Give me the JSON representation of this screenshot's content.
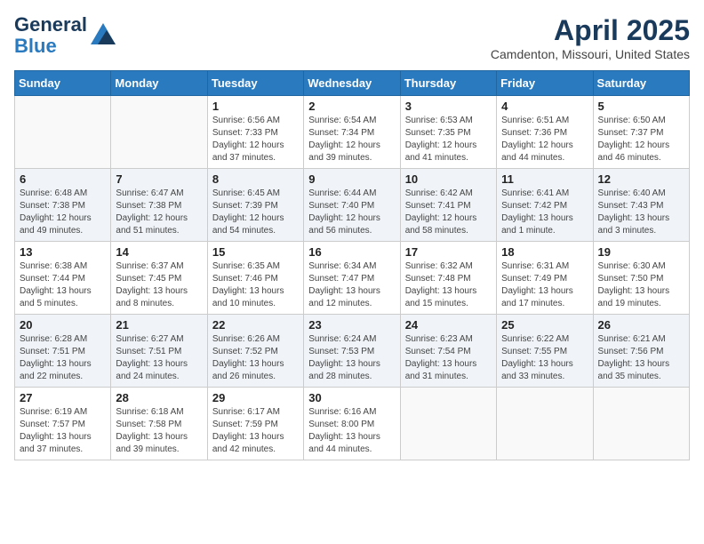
{
  "header": {
    "logo_line1": "General",
    "logo_line2": "Blue",
    "month_title": "April 2025",
    "location": "Camdenton, Missouri, United States"
  },
  "days_of_week": [
    "Sunday",
    "Monday",
    "Tuesday",
    "Wednesday",
    "Thursday",
    "Friday",
    "Saturday"
  ],
  "weeks": [
    [
      {
        "day": "",
        "info": ""
      },
      {
        "day": "",
        "info": ""
      },
      {
        "day": "1",
        "info": "Sunrise: 6:56 AM\nSunset: 7:33 PM\nDaylight: 12 hours and 37 minutes."
      },
      {
        "day": "2",
        "info": "Sunrise: 6:54 AM\nSunset: 7:34 PM\nDaylight: 12 hours and 39 minutes."
      },
      {
        "day": "3",
        "info": "Sunrise: 6:53 AM\nSunset: 7:35 PM\nDaylight: 12 hours and 41 minutes."
      },
      {
        "day": "4",
        "info": "Sunrise: 6:51 AM\nSunset: 7:36 PM\nDaylight: 12 hours and 44 minutes."
      },
      {
        "day": "5",
        "info": "Sunrise: 6:50 AM\nSunset: 7:37 PM\nDaylight: 12 hours and 46 minutes."
      }
    ],
    [
      {
        "day": "6",
        "info": "Sunrise: 6:48 AM\nSunset: 7:38 PM\nDaylight: 12 hours and 49 minutes."
      },
      {
        "day": "7",
        "info": "Sunrise: 6:47 AM\nSunset: 7:38 PM\nDaylight: 12 hours and 51 minutes."
      },
      {
        "day": "8",
        "info": "Sunrise: 6:45 AM\nSunset: 7:39 PM\nDaylight: 12 hours and 54 minutes."
      },
      {
        "day": "9",
        "info": "Sunrise: 6:44 AM\nSunset: 7:40 PM\nDaylight: 12 hours and 56 minutes."
      },
      {
        "day": "10",
        "info": "Sunrise: 6:42 AM\nSunset: 7:41 PM\nDaylight: 12 hours and 58 minutes."
      },
      {
        "day": "11",
        "info": "Sunrise: 6:41 AM\nSunset: 7:42 PM\nDaylight: 13 hours and 1 minute."
      },
      {
        "day": "12",
        "info": "Sunrise: 6:40 AM\nSunset: 7:43 PM\nDaylight: 13 hours and 3 minutes."
      }
    ],
    [
      {
        "day": "13",
        "info": "Sunrise: 6:38 AM\nSunset: 7:44 PM\nDaylight: 13 hours and 5 minutes."
      },
      {
        "day": "14",
        "info": "Sunrise: 6:37 AM\nSunset: 7:45 PM\nDaylight: 13 hours and 8 minutes."
      },
      {
        "day": "15",
        "info": "Sunrise: 6:35 AM\nSunset: 7:46 PM\nDaylight: 13 hours and 10 minutes."
      },
      {
        "day": "16",
        "info": "Sunrise: 6:34 AM\nSunset: 7:47 PM\nDaylight: 13 hours and 12 minutes."
      },
      {
        "day": "17",
        "info": "Sunrise: 6:32 AM\nSunset: 7:48 PM\nDaylight: 13 hours and 15 minutes."
      },
      {
        "day": "18",
        "info": "Sunrise: 6:31 AM\nSunset: 7:49 PM\nDaylight: 13 hours and 17 minutes."
      },
      {
        "day": "19",
        "info": "Sunrise: 6:30 AM\nSunset: 7:50 PM\nDaylight: 13 hours and 19 minutes."
      }
    ],
    [
      {
        "day": "20",
        "info": "Sunrise: 6:28 AM\nSunset: 7:51 PM\nDaylight: 13 hours and 22 minutes."
      },
      {
        "day": "21",
        "info": "Sunrise: 6:27 AM\nSunset: 7:51 PM\nDaylight: 13 hours and 24 minutes."
      },
      {
        "day": "22",
        "info": "Sunrise: 6:26 AM\nSunset: 7:52 PM\nDaylight: 13 hours and 26 minutes."
      },
      {
        "day": "23",
        "info": "Sunrise: 6:24 AM\nSunset: 7:53 PM\nDaylight: 13 hours and 28 minutes."
      },
      {
        "day": "24",
        "info": "Sunrise: 6:23 AM\nSunset: 7:54 PM\nDaylight: 13 hours and 31 minutes."
      },
      {
        "day": "25",
        "info": "Sunrise: 6:22 AM\nSunset: 7:55 PM\nDaylight: 13 hours and 33 minutes."
      },
      {
        "day": "26",
        "info": "Sunrise: 6:21 AM\nSunset: 7:56 PM\nDaylight: 13 hours and 35 minutes."
      }
    ],
    [
      {
        "day": "27",
        "info": "Sunrise: 6:19 AM\nSunset: 7:57 PM\nDaylight: 13 hours and 37 minutes."
      },
      {
        "day": "28",
        "info": "Sunrise: 6:18 AM\nSunset: 7:58 PM\nDaylight: 13 hours and 39 minutes."
      },
      {
        "day": "29",
        "info": "Sunrise: 6:17 AM\nSunset: 7:59 PM\nDaylight: 13 hours and 42 minutes."
      },
      {
        "day": "30",
        "info": "Sunrise: 6:16 AM\nSunset: 8:00 PM\nDaylight: 13 hours and 44 minutes."
      },
      {
        "day": "",
        "info": ""
      },
      {
        "day": "",
        "info": ""
      },
      {
        "day": "",
        "info": ""
      }
    ]
  ]
}
